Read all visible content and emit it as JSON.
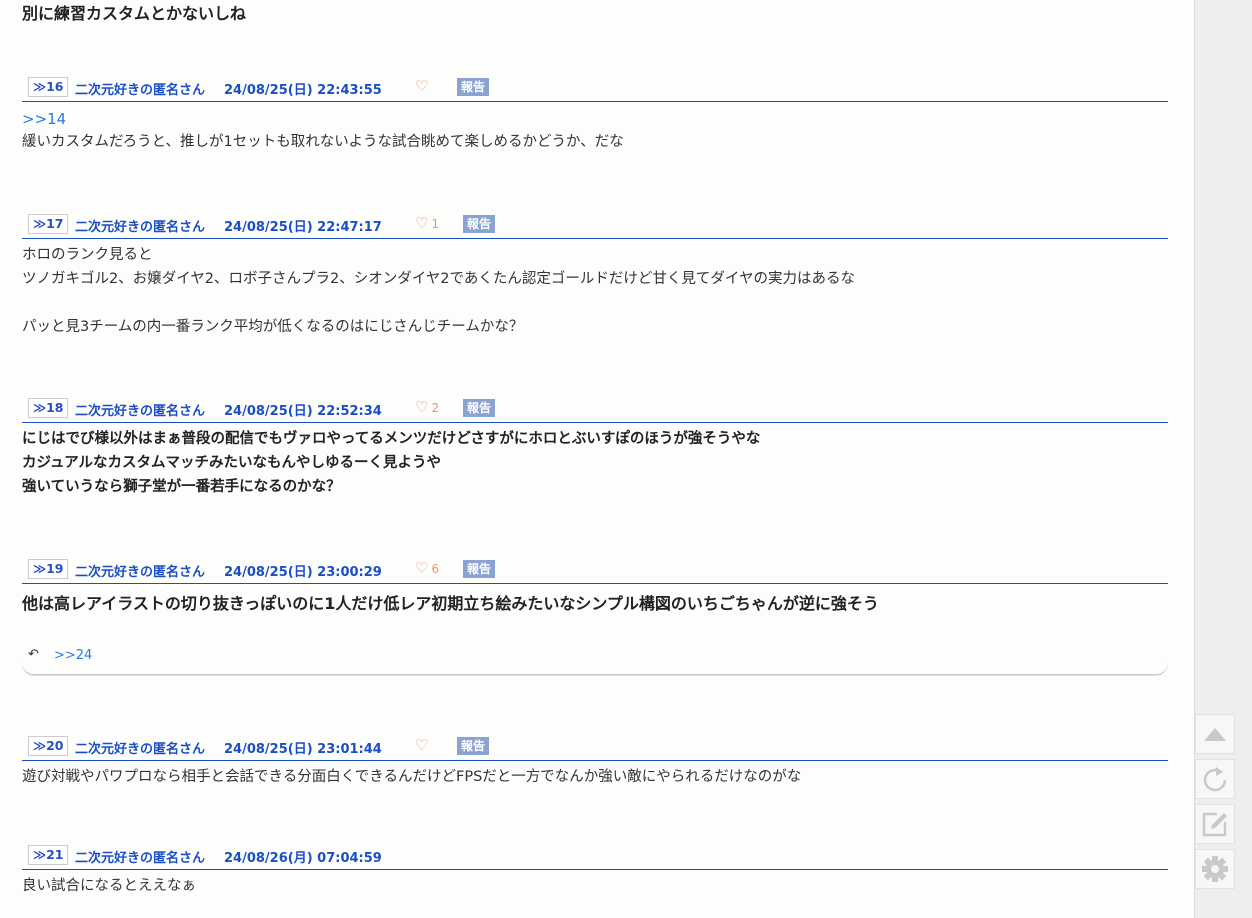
{
  "top_text": "別に練習カスタムとかないしね",
  "report_label": "報告",
  "posts": [
    {
      "num": "≫16",
      "name": "二次元好きの匿名さん",
      "date": "24/08/25(日) 22:43:55",
      "likes": "",
      "anchor": ">>14",
      "style": "normal",
      "lines": [
        "緩いカスタムだろうと、推しが1セットも取れないような試合眺めて楽しめるかどうか、だな"
      ]
    },
    {
      "num": "≫17",
      "name": "二次元好きの匿名さん",
      "date": "24/08/25(日) 22:47:17",
      "likes": "1",
      "style": "normal",
      "lines": [
        "ホロのランク見ると",
        "ツノガキゴル2、お嬢ダイヤ2、ロボ子さんプラ2、シオンダイヤ2であくたん認定ゴールドだけど甘く見てダイヤの実力はあるな",
        "",
        "パッと見3チームの内一番ランク平均が低くなるのはにじさんじチームかな？"
      ]
    },
    {
      "num": "≫18",
      "name": "二次元好きの匿名さん",
      "date": "24/08/25(日) 22:52:34",
      "likes": "2",
      "style": "bold",
      "lines": [
        "にじはでび様以外はまぁ普段の配信でもヴァロやってるメンツだけどさすがにホロとぶいすぽのほうが強そうやな",
        "カジュアルなカスタムマッチみたいなもんやしゆるーく見ようや",
        "強いていうなら獅子堂が一番若手になるのかな？"
      ]
    },
    {
      "num": "≫19",
      "name": "二次元好きの匿名さん",
      "date": "24/08/25(日) 23:00:29",
      "likes": "6",
      "style": "big",
      "lines": [
        "他は高レアイラストの切り抜きっぽいのに1人だけ低レア初期立ち絵みたいなシンプル構図のいちごちゃんが逆に強そう"
      ],
      "reply": ">>24"
    },
    {
      "num": "≫20",
      "name": "二次元好きの匿名さん",
      "date": "24/08/25(日) 23:01:44",
      "likes": "",
      "style": "normal",
      "lines": [
        "遊び対戦やパワプロなら相手と会話できる分面白くできるんだけどFPSだと一方でなんか強い敵にやられるだけなのがな"
      ]
    },
    {
      "num": "≫21",
      "name": "二次元好きの匿名さん",
      "date": "24/08/26(月) 07:04:59",
      "likes": null,
      "style": "normal",
      "lines": [
        "良い試合になるとええなぁ"
      ]
    }
  ],
  "sidebar": [
    "scroll-top",
    "reload",
    "write",
    "settings"
  ]
}
